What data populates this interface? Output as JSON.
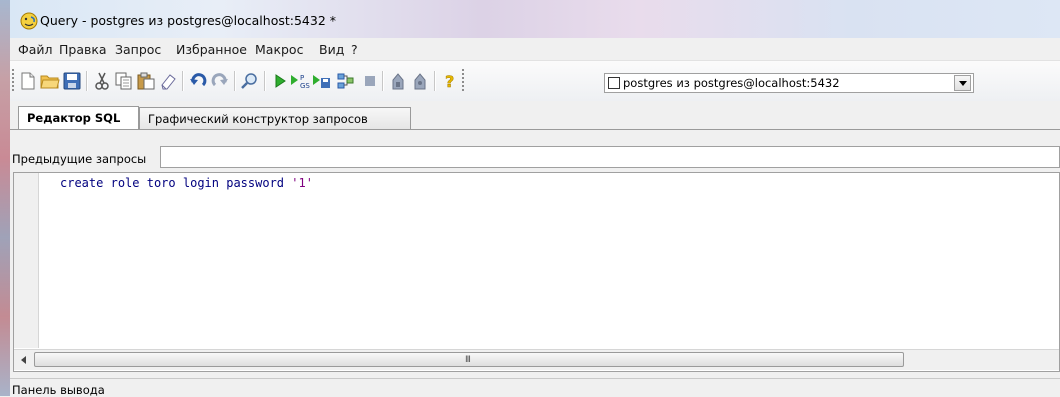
{
  "window": {
    "title": "Query - postgres из postgres@localhost:5432 *"
  },
  "menu": [
    {
      "label": "Файл"
    },
    {
      "label": "Правка"
    },
    {
      "label": "Запрос"
    },
    {
      "label": "Избранное"
    },
    {
      "label": "Макрос"
    },
    {
      "label": "Вид"
    },
    {
      "label": "?"
    }
  ],
  "toolbar": {
    "buttons": [
      "new-icon",
      "open-folder-icon",
      "save-icon",
      "cut-icon",
      "copy-icon",
      "paste-icon",
      "clear-icon",
      "undo-icon",
      "redo-icon",
      "find-icon",
      "execute-icon",
      "explain-icon",
      "execute-to-file-icon",
      "explain-options-icon",
      "stop-icon",
      "vacuum-icon",
      "analyze-icon",
      "help-icon"
    ],
    "connection_value": "postgres из postgres@localhost:5432"
  },
  "tabs": [
    {
      "label": "Редактор SQL",
      "active": true
    },
    {
      "label": "Графический конструктор запросов",
      "active": false
    }
  ],
  "previous_queries": {
    "label": "Предыдущие запросы",
    "value": ""
  },
  "editor": {
    "code": "create role toro login password '1'"
  },
  "scrollbar": {
    "grip": "III"
  },
  "output_panel": {
    "label": "Панель вывода"
  },
  "colors": {
    "keyword": "#00007f",
    "string": "#7f007f"
  }
}
